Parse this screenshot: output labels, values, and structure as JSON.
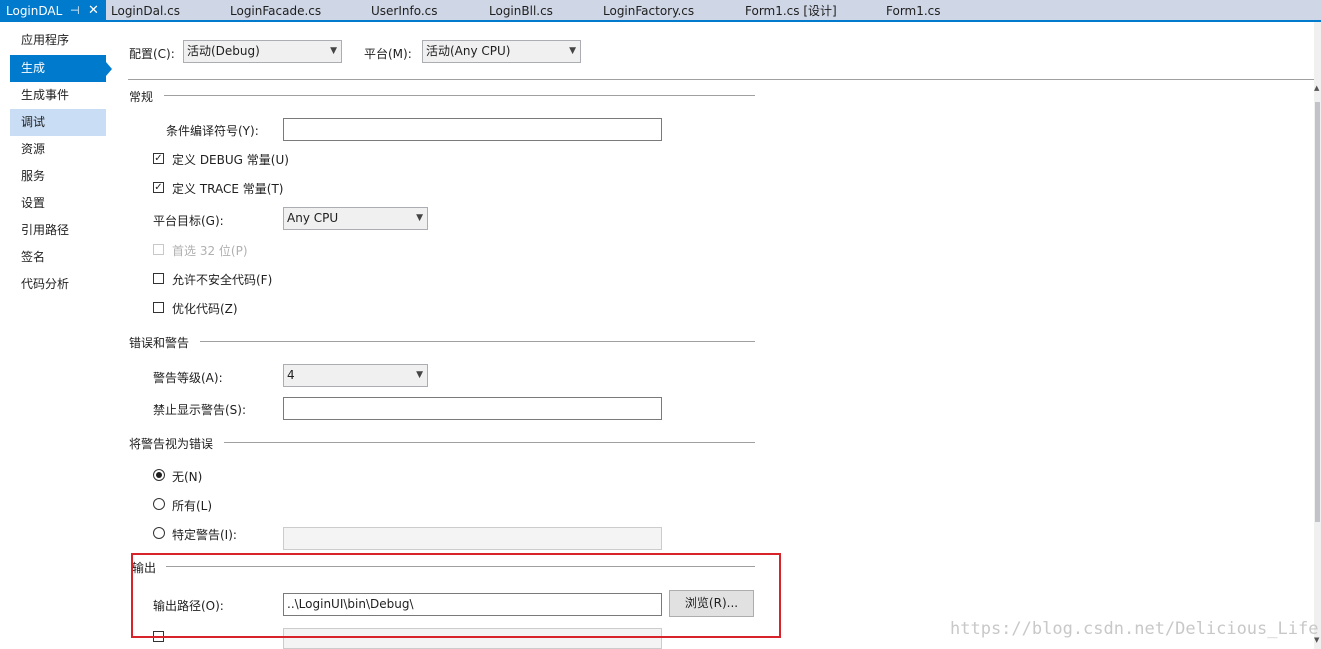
{
  "tabs": {
    "active": "LoginDAL",
    "items": [
      "LoginDal.cs",
      "LoginFacade.cs",
      "UserInfo.cs",
      "LoginBll.cs",
      "LoginFactory.cs",
      "Form1.cs [设计]",
      "Form1.cs"
    ]
  },
  "sidebar": {
    "items": [
      "应用程序",
      "生成",
      "生成事件",
      "调试",
      "资源",
      "服务",
      "设置",
      "引用路径",
      "签名",
      "代码分析"
    ],
    "selected": "生成"
  },
  "config": {
    "config_label": "配置(C):",
    "config_value": "活动(Debug)",
    "platform_label": "平台(M):",
    "platform_value": "活动(Any CPU)"
  },
  "general": {
    "title": "常规",
    "conditional_label": "条件编译符号(Y):",
    "conditional_value": "",
    "define_debug": "定义 DEBUG 常量(U)",
    "define_debug_checked": true,
    "define_trace": "定义 TRACE 常量(T)",
    "define_trace_checked": true,
    "platform_target_label": "平台目标(G):",
    "platform_target_value": "Any CPU",
    "prefer32": "首选 32 位(P)",
    "prefer32_enabled": false,
    "unsafe": "允许不安全代码(F)",
    "unsafe_checked": false,
    "optimize": "优化代码(Z)",
    "optimize_checked": false
  },
  "errors": {
    "title": "错误和警告",
    "warning_level_label": "警告等级(A):",
    "warning_level_value": "4",
    "suppress_label": "禁止显示警告(S):",
    "suppress_value": ""
  },
  "treat_warnings": {
    "title": "将警告视为错误",
    "none": "无(N)",
    "all": "所有(L)",
    "specific": "特定警告(I):",
    "selected": "none",
    "specific_value": ""
  },
  "output": {
    "title": "输出",
    "path_label": "输出路径(O):",
    "path_value": "..\\LoginUI\\bin\\Debug\\",
    "browse_label": "浏览(R)..."
  },
  "watermark": "https://blog.csdn.net/Delicious_Life"
}
